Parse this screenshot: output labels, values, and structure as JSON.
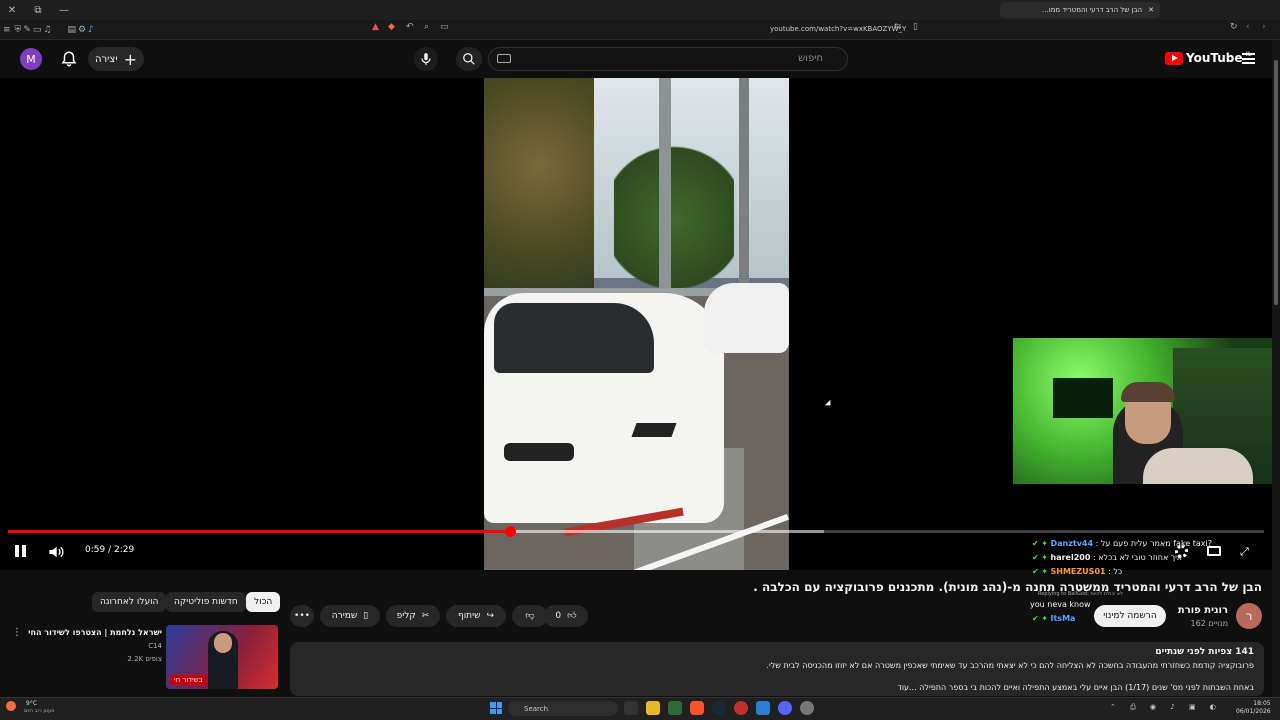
{
  "browser": {
    "tab_title": "הבן של הרב דרעי והמטריד ממו...",
    "url": "youtube.com/watch?v=wxKBAOZYW_Y"
  },
  "header": {
    "avatar_letter": "M",
    "create_label": "יצירה",
    "search_placeholder": "חיפוש",
    "logo_text": "YouTube",
    "logo_region": "IL"
  },
  "player": {
    "time": "0:59 / 2:29",
    "progress_fraction": 0.4,
    "buffered_fraction": 0.65,
    "state": "playing"
  },
  "chat": [
    {
      "user": "Danztv44",
      "text": ": מאמר עלית פעם על fake taxi?",
      "color": "#5aa3ff"
    },
    {
      "user": "harel200",
      "text": ": איך אחוזר טובי לא בכלא",
      "color": "#ffffff"
    },
    {
      "user": "SHMEZUS01",
      "text": ": כל",
      "color": "#ff9a3c"
    },
    {
      "user": "",
      "text": "you neva know",
      "color": "#ffffff"
    },
    {
      "user": "ItsMa",
      "text": "",
      "color": "#5aa3ff"
    }
  ],
  "chat_reply_label": "Replying to BallGod: לא יכולת להיות",
  "video": {
    "title": "הבן של הרב דרעי והמטריד ממשטרה תחנה מ-(נהג מונית). מתכננים פרובוקציה עם הכלבה .",
    "channel_name": "רונית פורת",
    "subscribers": "162 מנויים",
    "subscribe_label": "הרשמה למינוי",
    "channel_avatar_letter": "ר"
  },
  "actions": {
    "like_count": "0",
    "share_label": "שיתוף",
    "clip_label": "קליפ",
    "save_label": "שמירה"
  },
  "chips": [
    "הכול",
    "חדשות פוליטיקה",
    "הועלו לאחרונה"
  ],
  "description": {
    "stats": "141 צפיות  לפני שנתיים",
    "line1": "פרובוקציה קודמת  כשחזרתי מהעבודה בחשכה  לא הצליחה להם כי לא יצאתי מהרכב עד  שאימתי שאכפין משטרה אם לא יזוזו מהכניסה לבית שלי.",
    "line2": "באחת השבתות לפני מס' שנים  (1/17) הבן איים עלי באמצע התפילה ואיים להכות בי בספר התפילה ...עוד"
  },
  "recommended": {
    "title": "ישראל נלחמת | הצטרפו לשידור החי",
    "channel": "C14",
    "views": "2.2K צופים",
    "badge": "בשידור חי"
  },
  "taskbar": {
    "weather_temp": "9°C",
    "weather_desc": "מעונן רוב היום",
    "search_label": "Search",
    "time": "18:05",
    "date": "06/01/2026"
  }
}
